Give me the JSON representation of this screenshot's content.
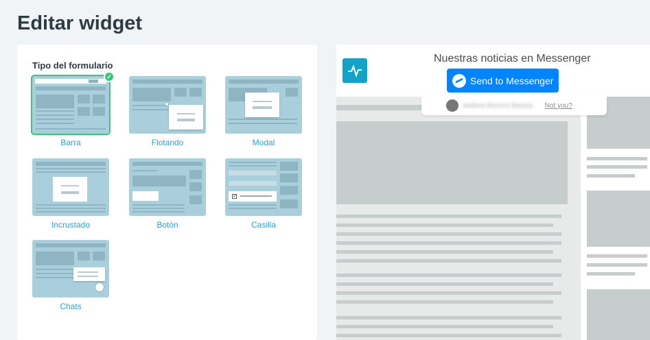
{
  "page": {
    "title": "Editar widget"
  },
  "form": {
    "section_title": "Tipo del formulario",
    "options": [
      {
        "label": "Barra",
        "selected": true
      },
      {
        "label": "Flotando",
        "selected": false
      },
      {
        "label": "Modal",
        "selected": false
      },
      {
        "label": "Incrustado",
        "selected": false
      },
      {
        "label": "Botón",
        "selected": false
      },
      {
        "label": "Casilla",
        "selected": false
      },
      {
        "label": "Chats",
        "selected": false
      }
    ]
  },
  "preview": {
    "title": "Nuestras noticias en Messenger",
    "button_label": "Send to Messenger",
    "user_name": "Andrea Moreno Baciza",
    "not_you": "Not you?"
  },
  "colors": {
    "accent": "#2f9ec7",
    "selected": "#3cc47c",
    "messenger": "#0084ff",
    "logo": "#14a3c7"
  }
}
